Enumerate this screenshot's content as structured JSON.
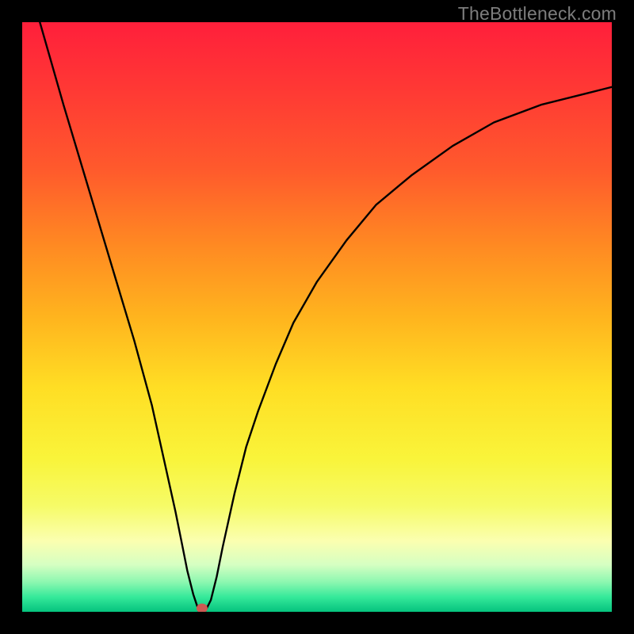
{
  "watermark": "TheBottleneck.com",
  "chart_data": {
    "type": "line",
    "title": "",
    "xlabel": "",
    "ylabel": "",
    "xlim": [
      0,
      100
    ],
    "ylim": [
      0,
      100
    ],
    "grid": false,
    "series": [
      {
        "name": "bottleneck-curve",
        "x": [
          3,
          5,
          7,
          10,
          13,
          16,
          19,
          22,
          24,
          26,
          27,
          28,
          29,
          30,
          31,
          32,
          33,
          34,
          36,
          38,
          40,
          43,
          46,
          50,
          55,
          60,
          66,
          73,
          80,
          88,
          96,
          100
        ],
        "values": [
          100,
          93,
          86,
          76,
          66,
          56,
          46,
          35,
          26,
          17,
          12,
          7,
          3,
          0,
          0,
          2,
          6,
          11,
          20,
          28,
          34,
          42,
          49,
          56,
          63,
          69,
          74,
          79,
          83,
          86,
          88,
          89
        ]
      }
    ],
    "marker": {
      "x": 30.5,
      "y": 0.6,
      "color": "#cc5a53"
    },
    "background_gradient": {
      "stops": [
        {
          "offset": 0.0,
          "color": "#ff1f3b"
        },
        {
          "offset": 0.12,
          "color": "#ff3a34"
        },
        {
          "offset": 0.25,
          "color": "#ff5a2c"
        },
        {
          "offset": 0.38,
          "color": "#ff8a22"
        },
        {
          "offset": 0.5,
          "color": "#ffb41e"
        },
        {
          "offset": 0.62,
          "color": "#ffde24"
        },
        {
          "offset": 0.74,
          "color": "#f9f43a"
        },
        {
          "offset": 0.82,
          "color": "#f6fb67"
        },
        {
          "offset": 0.88,
          "color": "#fbffb0"
        },
        {
          "offset": 0.92,
          "color": "#d6ffc2"
        },
        {
          "offset": 0.95,
          "color": "#8bf7b0"
        },
        {
          "offset": 0.975,
          "color": "#35e99a"
        },
        {
          "offset": 1.0,
          "color": "#05c37e"
        }
      ]
    }
  }
}
